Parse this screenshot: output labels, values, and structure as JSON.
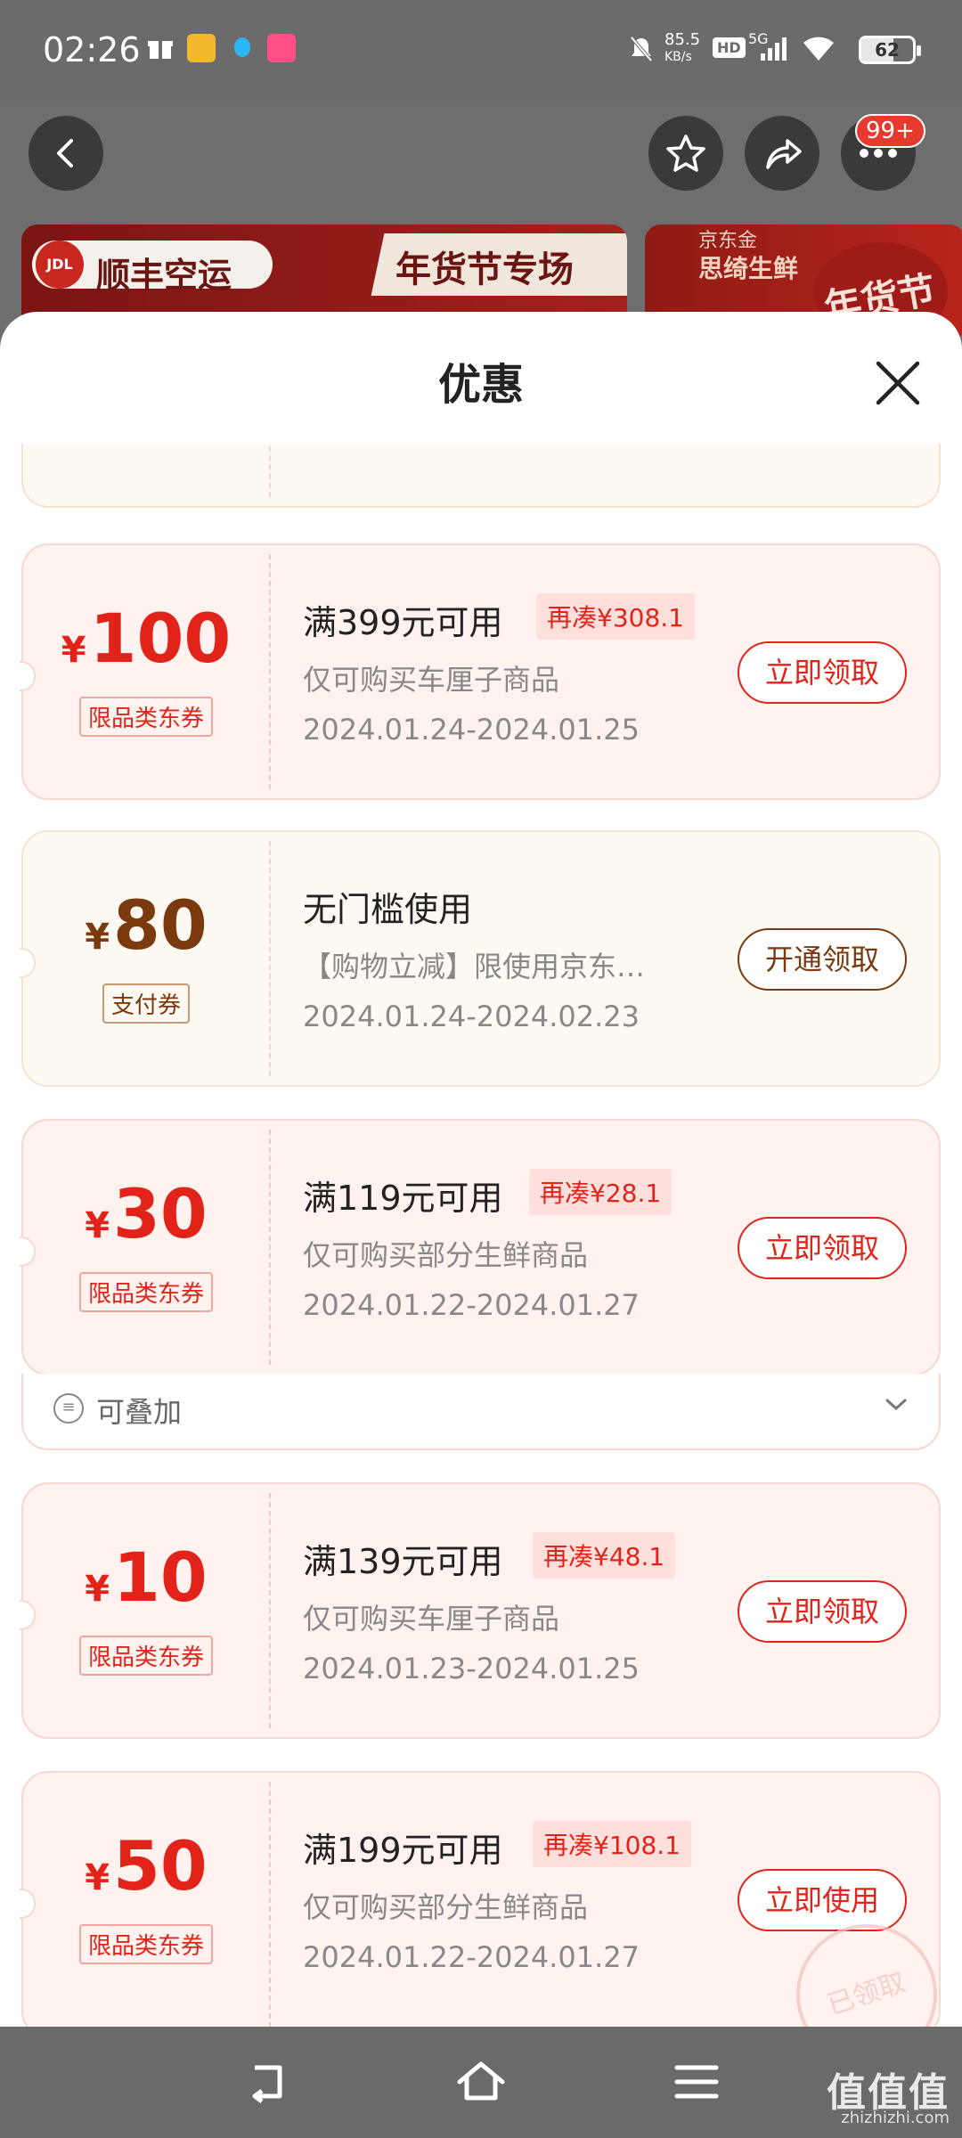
{
  "status_bar": {
    "time": "02:26",
    "net_speed": "85.5",
    "net_unit": "KB/s",
    "hd": "HD",
    "network": "5G",
    "battery_level": "62"
  },
  "top_nav": {
    "more_badge": "99+"
  },
  "banners": {
    "b1_logo_text": "顺丰空运",
    "b1_logo_badge": "JDL",
    "b1_promo_text": "年货节专场",
    "b2_line1": "京东金",
    "b2_line2": "思绮生鲜",
    "b2_stamp": "年货节"
  },
  "sheet": {
    "title": "优惠"
  },
  "coupons": [
    {
      "currency": "¥",
      "amount": "100",
      "tag": "限品类东券",
      "condition": "满399元可用",
      "extra": "再凑¥308.1",
      "description": "仅可购买车厘子商品",
      "date": "2024.01.24-2024.01.25",
      "action": "立即领取"
    },
    {
      "currency": "¥",
      "amount": "80",
      "tag": "支付券",
      "condition": "无门槛使用",
      "description": "【购物立减】限使用京东…",
      "date": "2024.01.24-2024.02.23",
      "action": "开通领取"
    },
    {
      "currency": "¥",
      "amount": "30",
      "tag": "限品类东券",
      "condition": "满119元可用",
      "extra": "再凑¥28.1",
      "description": "仅可购买部分生鲜商品",
      "date": "2024.01.22-2024.01.27",
      "action": "立即领取",
      "stackable_label": "可叠加"
    },
    {
      "currency": "¥",
      "amount": "10",
      "tag": "限品类东券",
      "condition": "满139元可用",
      "extra": "再凑¥48.1",
      "description": "仅可购买车厘子商品",
      "date": "2024.01.23-2024.01.25",
      "action": "立即领取"
    },
    {
      "currency": "¥",
      "amount": "50",
      "tag": "限品类东券",
      "condition": "满199元可用",
      "extra": "再凑¥108.1",
      "description": "仅可购买部分生鲜商品",
      "date": "2024.01.22-2024.01.27",
      "action": "立即使用",
      "stamp": "已领取"
    }
  ],
  "watermark": {
    "text": "值值值",
    "domain": "zhizhizhi.com"
  },
  "colors": {
    "accent_red": "#e2231a",
    "gold_brown": "#7a3a0e"
  }
}
